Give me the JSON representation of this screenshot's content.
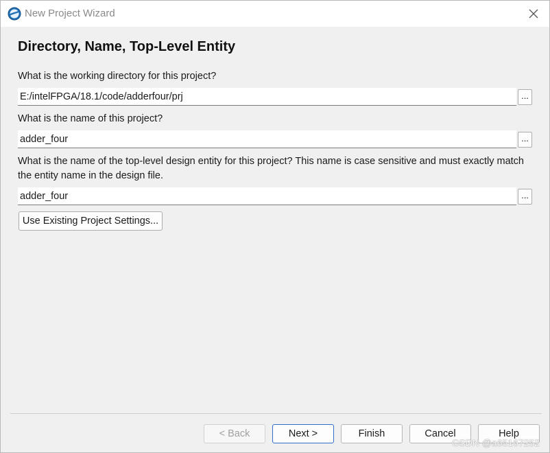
{
  "window": {
    "title": "New Project Wizard"
  },
  "page": {
    "heading": "Directory, Name, Top-Level Entity",
    "directory": {
      "label": "What is the working directory for this project?",
      "value": "E:/intelFPGA/18.1/code/adderfour/prj",
      "browse_label": "..."
    },
    "project_name": {
      "label": "What is the name of this project?",
      "value": "adder_four",
      "browse_label": "..."
    },
    "top_level": {
      "label": "What is the name of the top-level design entity for this project? This name is case sensitive and must exactly match the entity name in the design file.",
      "value": "adder_four",
      "browse_label": "..."
    },
    "existing_settings_label": "Use Existing Project Settings..."
  },
  "footer": {
    "back_label": "< Back",
    "next_label": "Next >",
    "finish_label": "Finish",
    "cancel_label": "Cancel",
    "help_label": "Help"
  },
  "watermark": "CSDN @a65167252",
  "icons": {
    "app": "quartus-app-icon",
    "close": "close-icon"
  }
}
